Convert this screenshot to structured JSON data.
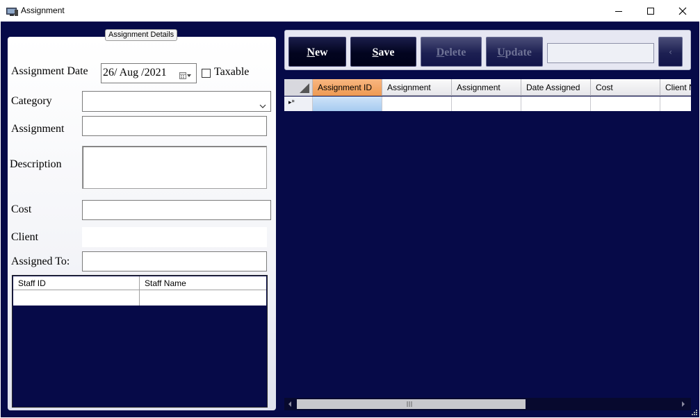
{
  "window": {
    "title": "Assignment",
    "icon": "computer-monitor-icon"
  },
  "details": {
    "group_caption": "Assignment Details",
    "assignment_date_label": "Assignment Date",
    "assignment_date_value": "26/ Aug /2021",
    "taxable_label": "Taxable",
    "taxable_checked": false,
    "category_label": "Category",
    "category_value": "",
    "assignment_label": "Assignment",
    "assignment_value": "",
    "description_label": "Description",
    "description_value": "",
    "cost_label": "Cost",
    "cost_value": "",
    "client_label": "Client",
    "client_value": "",
    "assigned_to_label": "Assigned To:",
    "assigned_to_value": ""
  },
  "staff_grid": {
    "columns": [
      "Staff ID",
      "Staff Name"
    ]
  },
  "toolbar": {
    "new_accel": "N",
    "new_rest": "ew",
    "save_accel": "S",
    "save_rest": "ave",
    "delete_accel": "D",
    "delete_rest": "elete",
    "update_accel": "U",
    "update_rest": "pdate",
    "search_value": "",
    "small_label": "‹"
  },
  "main_grid": {
    "columns": [
      "Assignment ID",
      "Assignment",
      "Assignment",
      "Date Assigned",
      "Cost",
      "Client N"
    ],
    "new_row_indicator": "▸*"
  },
  "colors": {
    "background": "#060a48",
    "header_selected": "#ee9a52",
    "cell_selected": "#a6cbf0"
  }
}
